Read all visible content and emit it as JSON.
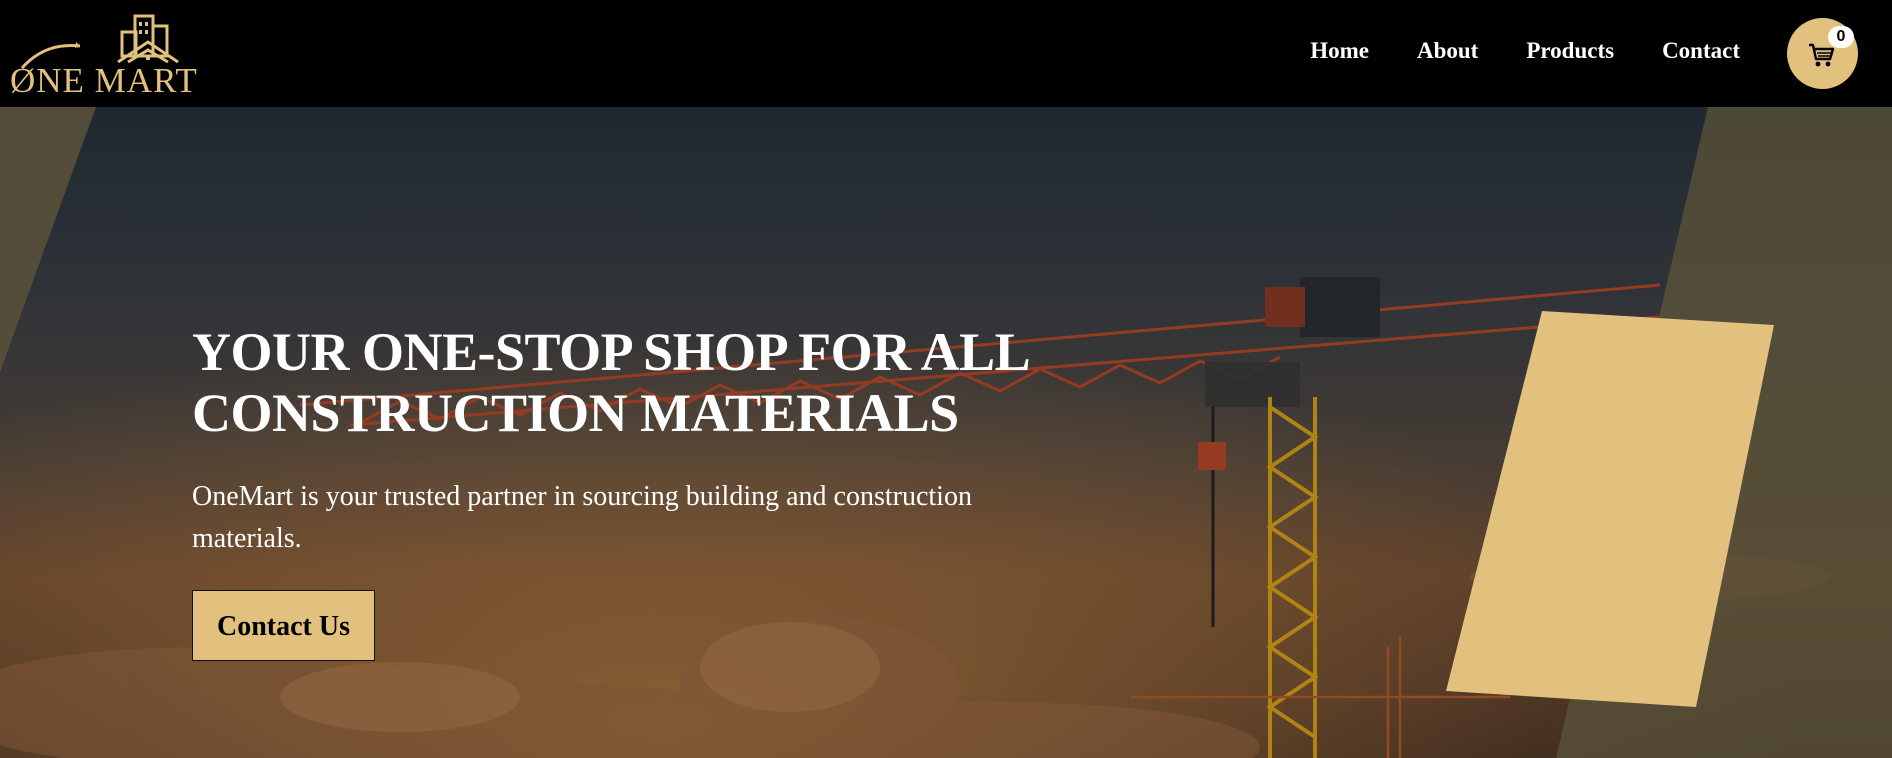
{
  "brand": {
    "name": "ØNE MART",
    "accent_color": "#e2c07e"
  },
  "nav": {
    "items": [
      {
        "label": "Home"
      },
      {
        "label": "About"
      },
      {
        "label": "Products"
      },
      {
        "label": "Contact"
      }
    ],
    "cart": {
      "icon": "shopping-cart-icon",
      "count": "0"
    }
  },
  "hero": {
    "title_line1": "YOUR ONE-STOP SHOP FOR ALL",
    "title_line2": "CONSTRUCTION MATERIALS",
    "subtitle": "OneMart is your trusted partner in sourcing building and construction materials.",
    "cta_label": "Contact Us",
    "background": "construction-crane-sunset-photo"
  }
}
